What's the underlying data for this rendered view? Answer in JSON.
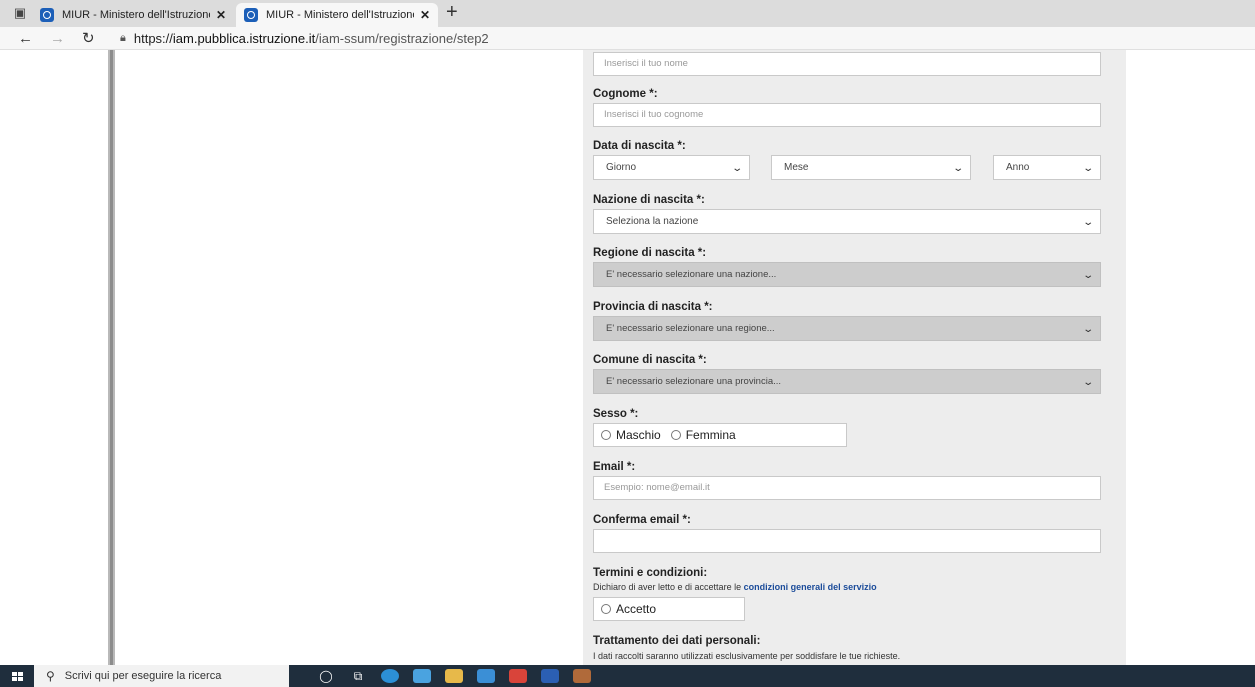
{
  "browser": {
    "tabs": [
      {
        "title": "MIUR - Ministero dell'Istruzione",
        "active": false
      },
      {
        "title": "MIUR - Ministero dell'Istruzione",
        "active": true
      }
    ],
    "new_tab_glyph": "+",
    "url_scheme": "https://",
    "url_host": "iam.pubblica.istruzione.it",
    "url_path": "/iam-ssum/registrazione/step2"
  },
  "form": {
    "nome_placeholder": "Inserisci il tuo nome",
    "cognome_label": "Cognome *:",
    "cognome_placeholder": "Inserisci il tuo cognome",
    "data_label": "Data di nascita *:",
    "giorno": "Giorno",
    "mese": "Mese",
    "anno": "Anno",
    "nazione_label": "Nazione di nascita *:",
    "nazione_value": "Seleziona la nazione",
    "regione_label": "Regione di nascita *:",
    "regione_value": "E' necessario selezionare una nazione...",
    "provincia_label": "Provincia di nascita *:",
    "provincia_value": "E' necessario selezionare una regione...",
    "comune_label": "Comune di nascita *:",
    "comune_value": "E' necessario selezionare una provincia...",
    "sesso_label": "Sesso *:",
    "maschio": "Maschio",
    "femmina": "Femmina",
    "email_label": "Email *:",
    "email_placeholder": "Esempio: nome@email.it",
    "conferma_label": "Conferma email *:",
    "conferma_value": "",
    "termini_label": "Termini e condizioni:",
    "termini_text": "Dichiaro di aver letto e di accettare le",
    "termini_link": "condizioni generali del servizio",
    "accetto": "Accetto",
    "trattamento_label": "Trattamento dei dati personali:",
    "trattamento_text": "I dati raccolti saranno utilizzati esclusivamente per soddisfare le tue richieste."
  },
  "taskbar": {
    "search_placeholder": "Scrivi qui per eseguire la ricerca"
  },
  "colors": {
    "accent_link": "#1c4c9a",
    "panel_bg": "#ededed",
    "disabled_select": "#cdcdcd",
    "taskbar_bg": "#1f2e3d"
  }
}
